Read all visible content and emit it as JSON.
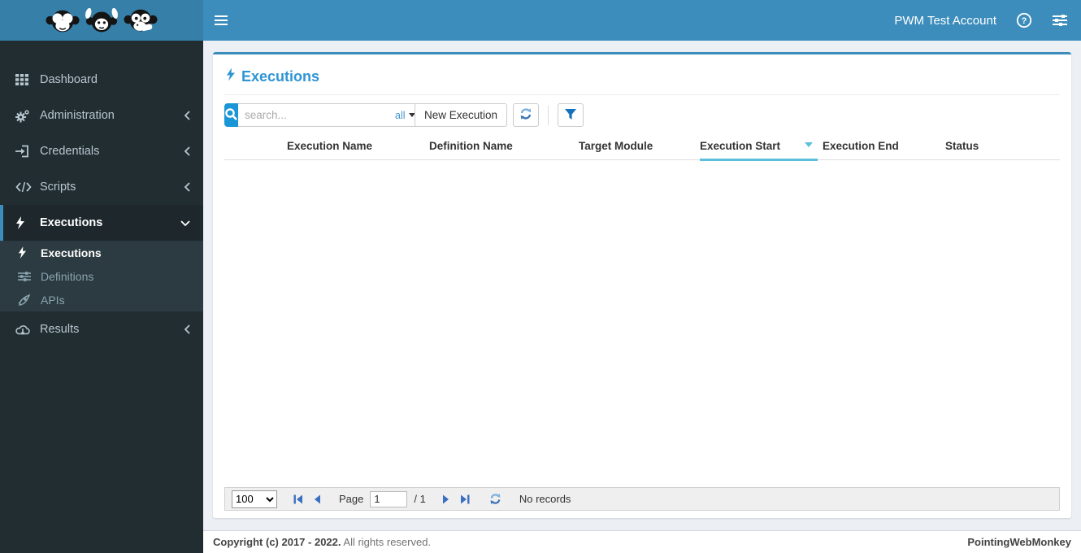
{
  "topbar": {
    "account": "PWM Test Account"
  },
  "sidebar": {
    "items": [
      {
        "label": "Dashboard",
        "icon": "grid-icon"
      },
      {
        "label": "Administration",
        "icon": "gears-icon",
        "chevron": "left"
      },
      {
        "label": "Credentials",
        "icon": "sign-in-icon",
        "chevron": "left"
      },
      {
        "label": "Scripts",
        "icon": "code-icon",
        "chevron": "left"
      },
      {
        "label": "Executions",
        "icon": "bolt-icon",
        "chevron": "down",
        "active": true,
        "children": [
          {
            "label": "Executions",
            "icon": "bolt-icon",
            "active": true
          },
          {
            "label": "Definitions",
            "icon": "sliders-icon"
          },
          {
            "label": "APIs",
            "icon": "rocket-icon"
          }
        ]
      },
      {
        "label": "Results",
        "icon": "cloud-download-icon",
        "chevron": "left"
      }
    ]
  },
  "main": {
    "heading": "Executions",
    "toolbar": {
      "search_placeholder": "search...",
      "search_scope": "all",
      "new_button": "New Execution"
    },
    "table": {
      "columns": [
        "",
        "Execution Name",
        "Definition Name",
        "Target Module",
        "Execution Start",
        "Execution End",
        "Status"
      ],
      "sorted_column": "Execution Start",
      "sort_direction": "desc",
      "rows": []
    },
    "pager": {
      "page_size": "100",
      "page_label": "Page",
      "page_value": "1",
      "total": "/ 1",
      "status": "No records"
    }
  },
  "footer": {
    "copyright": "Copyright (c) 2017 - 2022.",
    "rights": "All rights reserved.",
    "brand": "PointingWebMonkey"
  },
  "colors": {
    "navbar": "#3c8dbc",
    "logo_bg": "#367fa9",
    "sidebar": "#222d32",
    "submenu": "#2c3b41",
    "active_item_bg": "#1e282c",
    "active_border": "#3c8dbc",
    "heading": "#2e95d4",
    "search_button": "#1a96d7",
    "sort_indicator": "#5bc0de",
    "pager_arrow": "#3b6fc4"
  },
  "icons": {
    "three-monkeys-logo": "see-no-evil, hear-no-evil, speak-no-evil monkey faces",
    "hamburger-icon": "three horizontal bars",
    "question-circle-icon": "question mark in circle",
    "sliders-h-icon": "horizontal sliders",
    "search-icon": "magnifier",
    "refresh-icon": "two circular arrows",
    "filter-icon": "funnel",
    "first-page-icon": "bar + left triangle",
    "prev-page-icon": "left triangle",
    "next-page-icon": "right triangle",
    "last-page-icon": "right triangle + bar",
    "chevron-left-icon": "angle left",
    "chevron-down-icon": "angle down"
  }
}
